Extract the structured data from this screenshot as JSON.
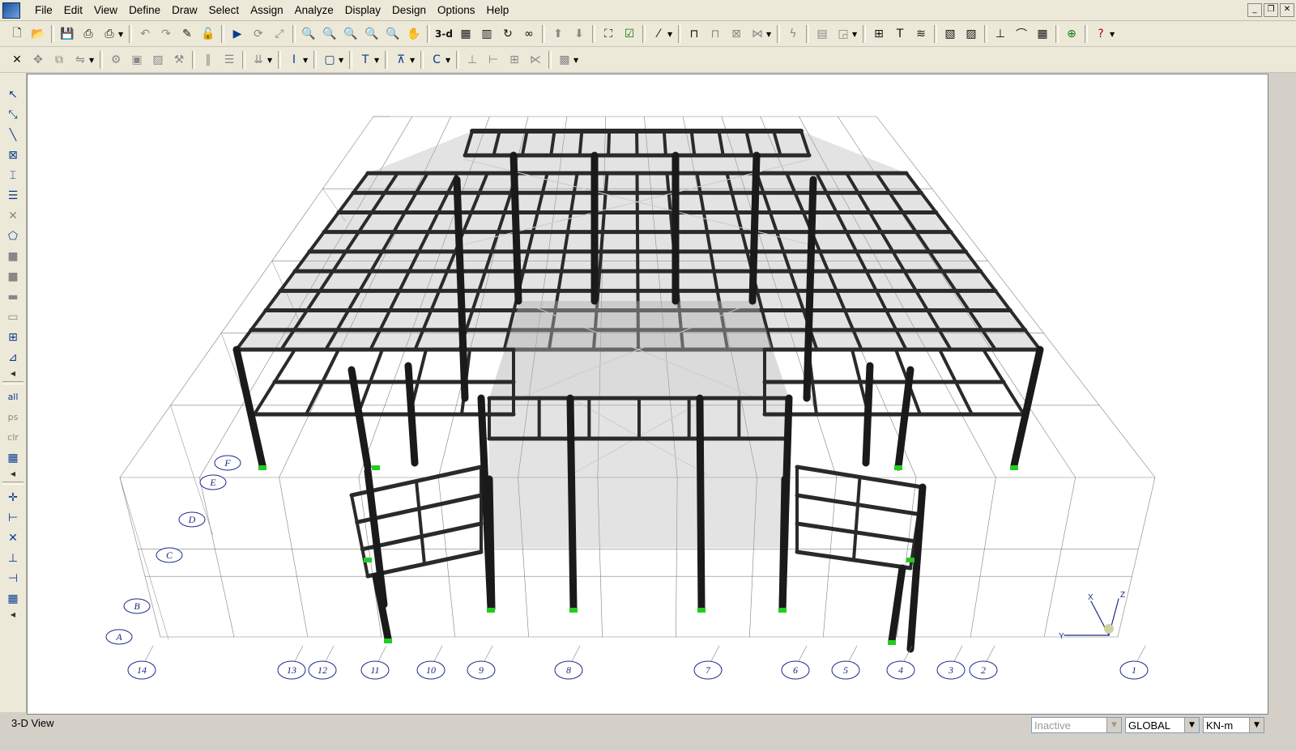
{
  "menubar": {
    "items": [
      "File",
      "Edit",
      "View",
      "Define",
      "Draw",
      "Select",
      "Assign",
      "Analyze",
      "Display",
      "Design",
      "Options",
      "Help"
    ],
    "window_controls": [
      "_",
      "❐",
      "✕"
    ]
  },
  "toolbar1": {
    "icons": [
      "new-file-icon",
      "open-icon",
      "save-icon",
      "print-icon",
      "print-setup-icon",
      "undo-icon",
      "redo-icon",
      "pencil-icon",
      "lock-icon",
      "run-icon",
      "refresh-icon",
      "zoom-window-icon",
      "zoom-in-icon",
      "zoom-out-icon",
      "zoom-extents-icon",
      "zoom-prev-icon",
      "pan-icon",
      "rotate-icon",
      "view-3d-label",
      "plan-view-icon",
      "elevation-view-icon",
      "rotate-3d-icon",
      "perspective-icon",
      "move-up-icon",
      "move-down-icon",
      "object-shrink-icon",
      "check-icon",
      "line-toggle-icon",
      "frame-icon",
      "portal-icon",
      "brace-icon",
      "truss-icon",
      "lightning-icon",
      "table-icon",
      "chart-icon",
      "grid-lines-icon",
      "text-icon",
      "layers-icon",
      "image-icon",
      "analysis-icon",
      "options-icon",
      "help-icon"
    ],
    "view_3d_label": "3-d"
  },
  "statusbar": {
    "view_label": "3-D View",
    "selector1": "Inactive",
    "selector2": "GLOBAL",
    "selector3": "KN-m"
  },
  "viewport": {
    "grid_numbers": [
      "14",
      "13",
      "12",
      "11",
      "10",
      "9",
      "8",
      "7",
      "6",
      "5",
      "4",
      "3",
      "2",
      "1"
    ],
    "grid_letters": [
      "F",
      "E",
      "D",
      "C",
      "B",
      "A"
    ],
    "axis_labels": {
      "x": "X",
      "y": "Y",
      "z": "Z"
    }
  },
  "colors": {
    "frame": "#2a2a2a",
    "support": "#22cc22",
    "grid": "#808080",
    "slab": "#b0b0b0"
  }
}
